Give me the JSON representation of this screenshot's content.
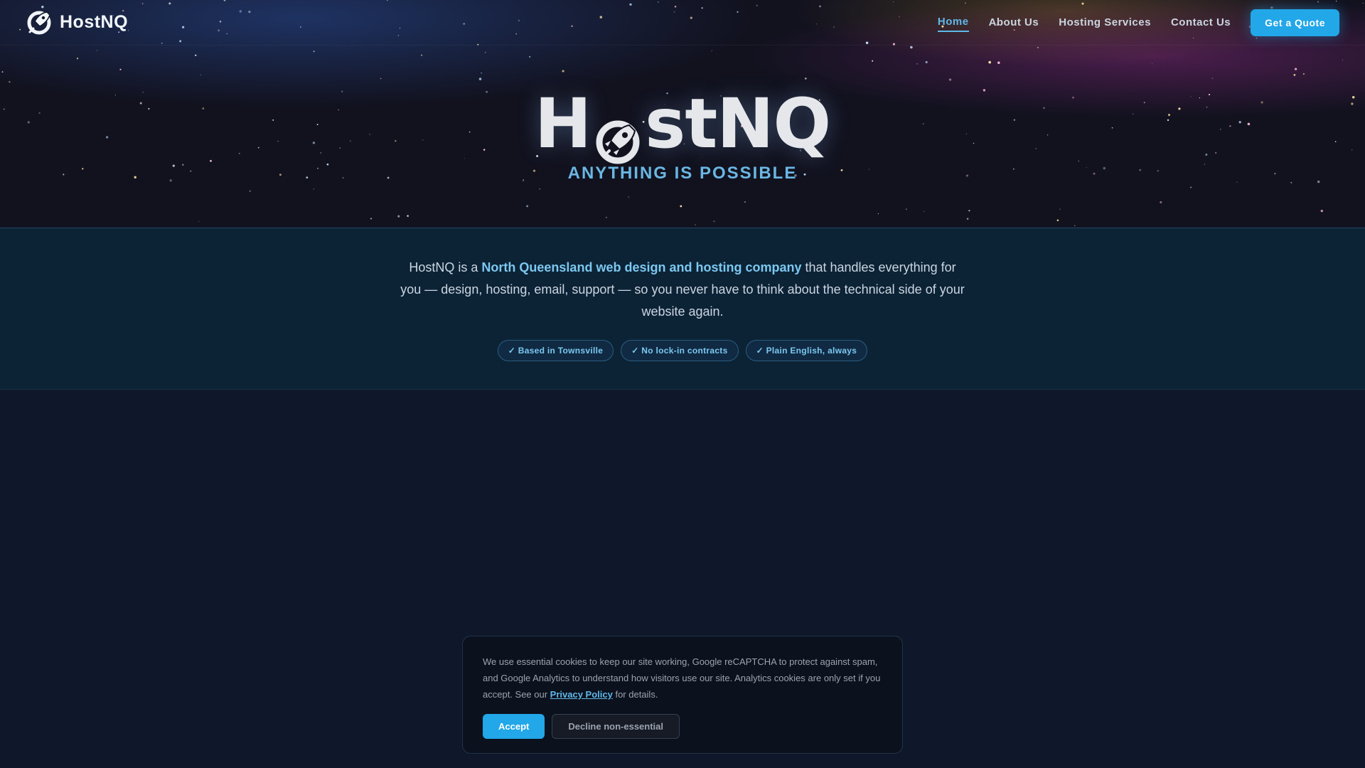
{
  "brand": {
    "name": "HostNQ",
    "logo_icon": "rocket-icon"
  },
  "nav": {
    "items": [
      {
        "label": "Home",
        "active": true
      },
      {
        "label": "About Us",
        "active": false
      },
      {
        "label": "Hosting Services",
        "active": false
      },
      {
        "label": "Contact Us",
        "active": false
      }
    ],
    "cta_label": "Get a Quote"
  },
  "hero": {
    "wordmark_prefix": "H",
    "wordmark_suffix": "stNQ",
    "tagline": "ANYTHING IS POSSIBLE"
  },
  "intro": {
    "text_before": "HostNQ is a ",
    "text_highlight": "North Queensland web design and hosting company",
    "text_after": " that handles everything for you — design, hosting, email, support — so you never have to think about the technical side of your website again.",
    "badges": [
      "✓ Based in Townsville",
      "✓ No lock-in contracts",
      "✓ Plain English, always"
    ]
  },
  "cookie": {
    "text_before": "We use essential cookies to keep our site working, Google reCAPTCHA to protect against spam, and Google Analytics to understand how visitors use our site. Analytics cookies are only set if you accept. See our ",
    "link_label": "Privacy Policy",
    "text_after": " for details.",
    "accept_label": "Accept",
    "decline_label": "Decline non-essential"
  },
  "colors": {
    "accent": "#22a7e8",
    "link": "#60b8e8",
    "background": "#0f172a",
    "intro_band": "#0c2336"
  }
}
